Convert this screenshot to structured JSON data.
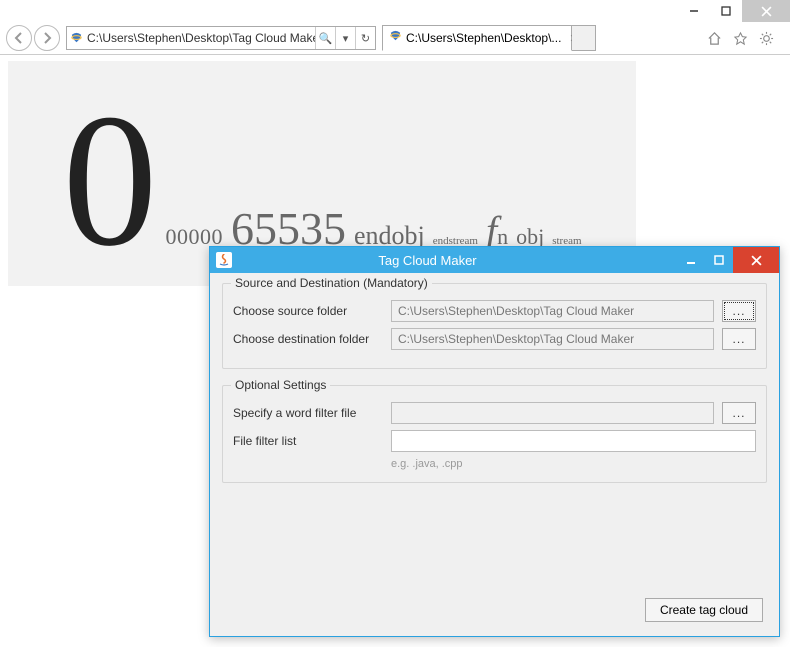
{
  "browser": {
    "address": "C:\\Users\\Stephen\\Desktop\\Tag Cloud Make",
    "tab_label": "C:\\Users\\Stephen\\Desktop\\...",
    "search_glyph": "🔍",
    "dropdown_glyph": "▾",
    "refresh_glyph": "↻"
  },
  "cloud": {
    "big": "0",
    "w_00000": "00000",
    "w_65535": "65535",
    "w_endobj": "endobj",
    "w_endstream": "endstream",
    "w_f": "f",
    "w_n": "n",
    "w_obj": "obj",
    "w_stream": "stream"
  },
  "dialog": {
    "title": "Tag Cloud Maker",
    "group1_title": "Source and Destination (Mandatory)",
    "src_label": "Choose source folder",
    "src_value": "C:\\Users\\Stephen\\Desktop\\Tag Cloud Maker",
    "dest_label": "Choose destination folder",
    "dest_value": "C:\\Users\\Stephen\\Desktop\\Tag Cloud Maker",
    "group2_title": "Optional Settings",
    "filter_file_label": "Specify a word filter file",
    "filter_file_value": "",
    "filter_list_label": "File filter list",
    "filter_list_value": "",
    "filter_list_hint": "e.g. .java, .cpp",
    "browse_label": "...",
    "create_button": "Create tag cloud"
  }
}
